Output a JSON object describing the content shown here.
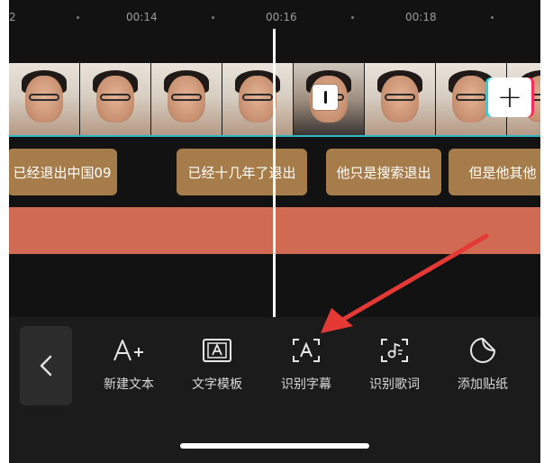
{
  "ruler": {
    "left_partial": "2",
    "t14": "00:14",
    "t16": "00:16",
    "t18": "00:18"
  },
  "timeline": {
    "captions": [
      "已经退出中国09",
      "已经十几年了退出",
      "他只是搜索退出",
      "但是他其他"
    ]
  },
  "toolbar": {
    "tools": [
      {
        "label": "新建文本",
        "icon": "add-text-icon"
      },
      {
        "label": "文字模板",
        "icon": "text-template-icon"
      },
      {
        "label": "识别字幕",
        "icon": "recognize-subtitles-icon"
      },
      {
        "label": "识别歌词",
        "icon": "recognize-lyrics-icon"
      },
      {
        "label": "添加贴纸",
        "icon": "add-sticker-icon"
      }
    ]
  },
  "annotation": {
    "arrow_color": "#e53935"
  },
  "colors": {
    "caption": "#a67c4a",
    "audio": "#d16a53",
    "track_line": "#2fb7c7"
  }
}
